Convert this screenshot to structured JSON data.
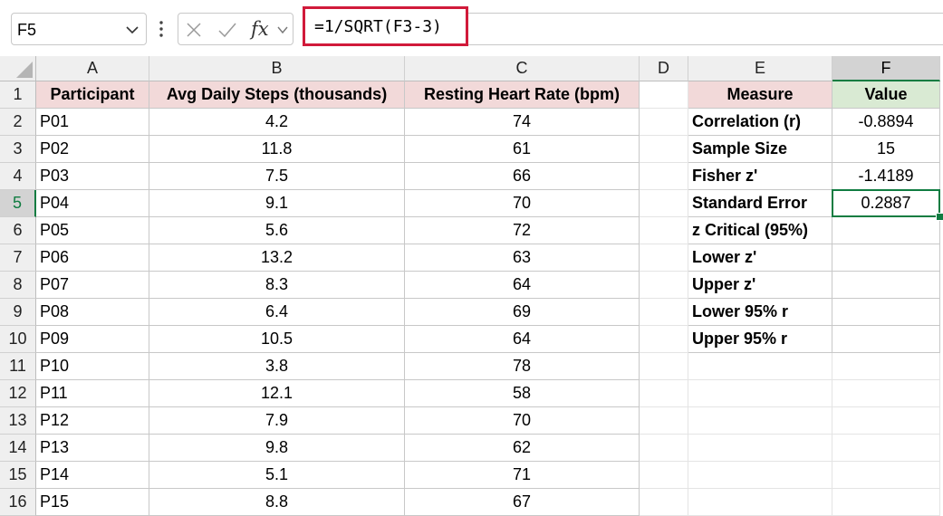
{
  "name_box": {
    "value": "F5"
  },
  "formula_bar": {
    "formula": "=1/SQRT(F3-3)",
    "fx_label": "fx"
  },
  "columns": [
    "A",
    "B",
    "C",
    "D",
    "E",
    "F"
  ],
  "selected_column": "F",
  "selected_row": 5,
  "rows": [
    "1",
    "2",
    "3",
    "4",
    "5",
    "6",
    "7",
    "8",
    "9",
    "10",
    "11",
    "12",
    "13",
    "14",
    "15",
    "16"
  ],
  "table": {
    "headers": [
      "Participant",
      "Avg Daily Steps (thousands)",
      "Resting Heart Rate (bpm)"
    ],
    "rows": [
      [
        "P01",
        "4.2",
        "74"
      ],
      [
        "P02",
        "11.8",
        "61"
      ],
      [
        "P03",
        "7.5",
        "66"
      ],
      [
        "P04",
        "9.1",
        "70"
      ],
      [
        "P05",
        "5.6",
        "72"
      ],
      [
        "P06",
        "13.2",
        "63"
      ],
      [
        "P07",
        "8.3",
        "64"
      ],
      [
        "P08",
        "6.4",
        "69"
      ],
      [
        "P09",
        "10.5",
        "64"
      ],
      [
        "P10",
        "3.8",
        "78"
      ],
      [
        "P11",
        "12.1",
        "58"
      ],
      [
        "P12",
        "7.9",
        "70"
      ],
      [
        "P13",
        "9.8",
        "62"
      ],
      [
        "P14",
        "5.1",
        "71"
      ],
      [
        "P15",
        "8.8",
        "67"
      ]
    ]
  },
  "measures": {
    "headers": [
      "Measure",
      "Value"
    ],
    "rows": [
      [
        "Correlation (r)",
        "-0.8894"
      ],
      [
        "Sample Size",
        "15"
      ],
      [
        "Fisher z'",
        "-1.4189"
      ],
      [
        "Standard Error",
        "0.2887"
      ],
      [
        "z Critical (95%)",
        ""
      ],
      [
        "Lower z'",
        ""
      ],
      [
        "Upper z'",
        ""
      ],
      [
        "Lower 95% r",
        ""
      ],
      [
        "Upper 95% r",
        ""
      ]
    ]
  },
  "colors": {
    "header_pink": "#f2d9d9",
    "header_green": "#d9ead3",
    "selection_green": "#107c41",
    "formula_highlight": "#d11a3a"
  },
  "icons": [
    "chevron-down-icon",
    "more-options-icon",
    "cancel-x-icon",
    "confirm-check-icon",
    "insert-function-icon"
  ]
}
